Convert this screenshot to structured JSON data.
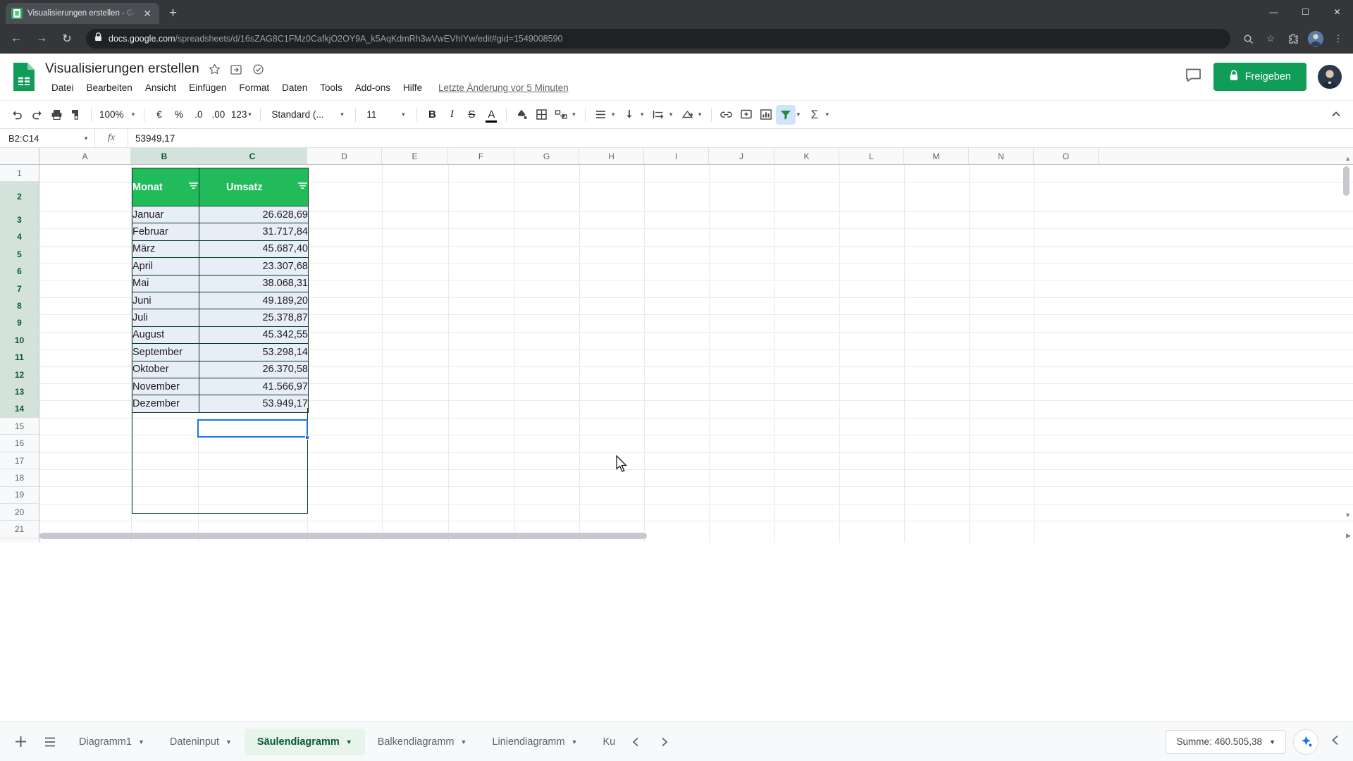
{
  "browser": {
    "tab_title": "Visualisierungen erstellen - Goog",
    "favicon_name": "google-sheets-favicon",
    "close_tab_label": "✕",
    "new_tab_label": "+",
    "back_label": "←",
    "forward_label": "→",
    "reload_label": "↻",
    "url_domain": "docs.google.com",
    "url_path": "/spreadsheets/d/16sZAG8C1FMz0CafkjO2OY9A_k5AqKdmRh3wVwEVhIYw/edit#gid=1549008590",
    "window_minimize": "—",
    "window_maximize": "☐",
    "window_close": "✕"
  },
  "doc": {
    "title": "Visualisierungen erstellen",
    "star_icon": "star-icon",
    "move_icon": "move-to-folder-icon",
    "cloud_icon": "cloud-saved-icon",
    "last_edit": "Letzte Änderung vor 5 Minuten",
    "share_label": "Freigeben",
    "share_color": "#0f9d58",
    "comment_icon": "comment-icon"
  },
  "menu": {
    "items": [
      "Datei",
      "Bearbeiten",
      "Ansicht",
      "Einfügen",
      "Format",
      "Daten",
      "Tools",
      "Add-ons",
      "Hilfe"
    ]
  },
  "toolbar": {
    "undo": "undo-icon",
    "redo": "redo-icon",
    "print": "print-icon",
    "paint": "paint-format-icon",
    "zoom_value": "100%",
    "currency": "€",
    "percent": "%",
    "dec_less": ".0",
    "dec_more": ".00",
    "formats": "123",
    "font_family": "Standard (...",
    "font_size": "11",
    "bold": "B",
    "italic": "I",
    "strike": "S",
    "text_color": "A",
    "text_color_swatch": "#000000",
    "fill": "fill-color-icon",
    "borders": "borders-icon",
    "merge": "merge-cells-icon",
    "align": "horizontal-align-icon",
    "valign": "vertical-align-icon",
    "wrap": "text-wrap-icon",
    "rotate": "text-rotation-icon",
    "link": "insert-link-icon",
    "comment": "insert-comment-icon",
    "chart": "insert-chart-icon",
    "filter": "filter-icon",
    "filter_active_color": "#1e8e3e",
    "functions": "Σ",
    "collapse": "collapse-toolbar-icon"
  },
  "formula_bar": {
    "name_box": "B2:C14",
    "fx_label": "fx",
    "formula_value": "53949,17"
  },
  "grid": {
    "columns": [
      "A",
      "B",
      "C",
      "D",
      "E",
      "F",
      "G",
      "H",
      "I",
      "J",
      "K",
      "L",
      "M",
      "N",
      "O"
    ],
    "selected_columns": [
      "B",
      "C"
    ],
    "rows": [
      "1",
      "2",
      "3",
      "4",
      "5",
      "6",
      "7",
      "8",
      "9",
      "10",
      "11",
      "12",
      "13",
      "14",
      "15",
      "16",
      "17",
      "18",
      "19",
      "20",
      "21"
    ],
    "selected_rows": [
      "2",
      "3",
      "4",
      "5",
      "6",
      "7",
      "8",
      "9",
      "10",
      "11",
      "12",
      "13",
      "14"
    ]
  },
  "table": {
    "headers": [
      "Monat",
      "Umsatz"
    ],
    "header_bg": "#22bb5b",
    "cell_bg": "#e8eef7",
    "filter_icon": "filter-funnel-icon",
    "rows": [
      {
        "month": "Januar",
        "value": "26.628,69"
      },
      {
        "month": "Februar",
        "value": "31.717,84"
      },
      {
        "month": "März",
        "value": "45.687,40"
      },
      {
        "month": "April",
        "value": "23.307,68"
      },
      {
        "month": "Mai",
        "value": "38.068,31"
      },
      {
        "month": "Juni",
        "value": "49.189,20"
      },
      {
        "month": "Juli",
        "value": "25.378,87"
      },
      {
        "month": "August",
        "value": "45.342,55"
      },
      {
        "month": "September",
        "value": "53.298,14"
      },
      {
        "month": "Oktober",
        "value": "26.370,58"
      },
      {
        "month": "November",
        "value": "41.566,97"
      },
      {
        "month": "Dezember",
        "value": "53.949,17"
      }
    ]
  },
  "bottom": {
    "add_sheet_icon": "add-sheet-icon",
    "all_sheets_icon": "all-sheets-icon",
    "tabs": [
      {
        "label": "Diagramm1",
        "active": false
      },
      {
        "label": "Dateninput",
        "active": false
      },
      {
        "label": "Säulendiagramm",
        "active": true
      },
      {
        "label": "Balkendiagramm",
        "active": false
      },
      {
        "label": "Liniendiagramm",
        "active": false
      },
      {
        "label": "Ku",
        "active": false
      }
    ],
    "prev_arrow": "◀",
    "next_arrow": "▶",
    "sum_label": "Summe: 460.505,38",
    "explore_icon": "explore-icon",
    "collapse_icon": "collapse-panel-icon"
  }
}
